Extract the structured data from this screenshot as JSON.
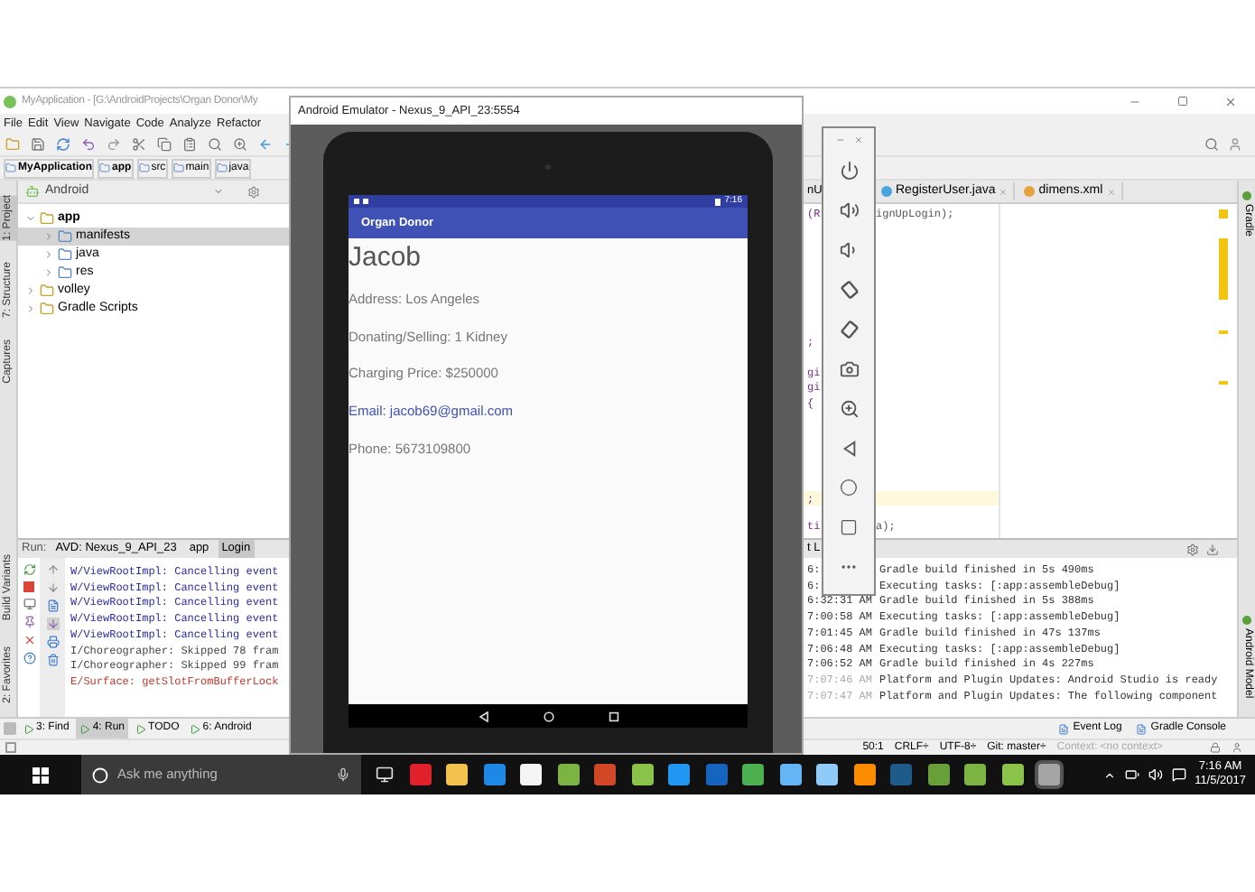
{
  "ide": {
    "title": "MyApplication - [G:\\AndroidProjects\\Organ Donor\\My",
    "menu": [
      "File",
      "Edit",
      "View",
      "Navigate",
      "Code",
      "Analyze",
      "Refactor"
    ],
    "breadcrumbs": [
      "MyApplication",
      "app",
      "src",
      "main",
      "java"
    ],
    "project_view": "Android",
    "left_tabs_top": [
      {
        "label": "1: Project",
        "selected": true
      },
      {
        "label": "7: Structure",
        "selected": false
      },
      {
        "label": "Captures",
        "selected": false
      }
    ],
    "left_tabs_bottom": [
      {
        "label": "Build Variants",
        "selected": false
      },
      {
        "label": "2: Favorites",
        "selected": false
      }
    ],
    "tree": [
      {
        "label": "app",
        "expanded": true,
        "selected": false,
        "children": [
          {
            "label": "manifests",
            "expanded": false,
            "selected": true
          },
          {
            "label": "java",
            "expanded": false,
            "selected": false
          },
          {
            "label": "res",
            "expanded": false,
            "selected": false
          }
        ]
      },
      {
        "label": "volley",
        "expanded": false,
        "selected": false
      },
      {
        "label": "Gradle Scripts",
        "expanded": false,
        "selected": false
      }
    ],
    "editor_tabs": [
      "nU",
      "RegisterUser.java",
      "dimens.xml"
    ],
    "code_lines": [
      {
        "left": "(R",
        "right": "ignUpLogin);",
        "highlighted": false
      },
      {
        "left": ";",
        "highlighted": false
      },
      {
        "left": "gi",
        "highlighted": false
      },
      {
        "left": "gi",
        "highlighted": false
      },
      {
        "left": "{",
        "highlighted": false
      },
      {
        "left": ";",
        "highlighted": true
      },
      {
        "left": "ti",
        "right": "a);",
        "highlighted": false
      }
    ],
    "right_tabs": [
      "Gradle",
      "Android Model"
    ],
    "run_panel": {
      "label": "Run:",
      "tabs": [
        {
          "label": "AVD: Nexus_9_API_23",
          "selected": false
        },
        {
          "label": "app",
          "selected": false
        },
        {
          "label": "Login",
          "selected": true
        }
      ],
      "log": [
        {
          "kind": "warning",
          "text": "W/ViewRootImpl: Cancelling event"
        },
        {
          "kind": "warning",
          "text": "W/ViewRootImpl: Cancelling event"
        },
        {
          "kind": "warning",
          "text": "W/ViewRootImpl: Cancelling event"
        },
        {
          "kind": "warning",
          "text": "W/ViewRootImpl: Cancelling event"
        },
        {
          "kind": "warning",
          "text": "W/ViewRootImpl: Cancelling event"
        },
        {
          "kind": "info",
          "text": "I/Choreographer: Skipped 78 fram"
        },
        {
          "kind": "info",
          "text": "I/Choreographer: Skipped 99 fram"
        },
        {
          "kind": "error",
          "text": "E/Surface: getSlotFromBufferLock"
        }
      ]
    },
    "event_log": {
      "title": "t L",
      "entries": [
        {
          "time": "6:",
          "message": "Gradle build finished in 5s 490ms",
          "dimmed": false
        },
        {
          "time": "6:",
          "message": "Executing tasks: [:app:assembleDebug]",
          "dimmed": false
        },
        {
          "time": "6:32:31 AM",
          "message": "Gradle build finished in 5s 388ms",
          "dimmed": false
        },
        {
          "time": "7:00:58 AM",
          "message": "Executing tasks: [:app:assembleDebug]",
          "dimmed": false
        },
        {
          "time": "7:01:45 AM",
          "message": "Gradle build finished in 47s 137ms",
          "dimmed": false
        },
        {
          "time": "7:06:48 AM",
          "message": "Executing tasks: [:app:assembleDebug]",
          "dimmed": false
        },
        {
          "time": "7:06:52 AM",
          "message": "Gradle build finished in 4s 227ms",
          "dimmed": false
        },
        {
          "time": "7:07:46 AM",
          "message": "Platform and Plugin Updates: Android Studio is ready",
          "dimmed": true
        },
        {
          "time": "7:07:47 AM",
          "message": "Platform and Plugin Updates: The following component",
          "dimmed": true
        }
      ]
    },
    "bottom_tabs": [
      {
        "label": "3: Find",
        "selected": false
      },
      {
        "label": "4: Run",
        "selected": true
      },
      {
        "label": "TODO",
        "selected": false
      },
      {
        "label": "6: Android",
        "selected": false
      }
    ],
    "bottom_right_tabs": [
      "Event Log",
      "Gradle Console"
    ],
    "status_bar": {
      "items": [
        "50:1",
        "CRLF÷",
        "UTF-8÷",
        "Git: master÷"
      ],
      "context": "Context: <no context>"
    }
  },
  "emulator": {
    "title": "Android Emulator - Nexus_9_API_23:5554",
    "status_time": "7:16",
    "app_title": "Organ Donor",
    "name": "Jacob",
    "fields": [
      {
        "text": "Address: Los Angeles",
        "kind": "plain"
      },
      {
        "text": "Donating/Selling: 1 Kidney",
        "kind": "plain"
      },
      {
        "text": "Charging Price: $250000",
        "kind": "plain"
      },
      {
        "text": "Email: jacob69@gmail.com",
        "kind": "link"
      },
      {
        "text": "Phone: 5673109800",
        "kind": "plain"
      }
    ]
  },
  "taskbar": {
    "search_placeholder": "Ask me anything",
    "time": "7:16 AM",
    "date": "11/5/2017"
  }
}
